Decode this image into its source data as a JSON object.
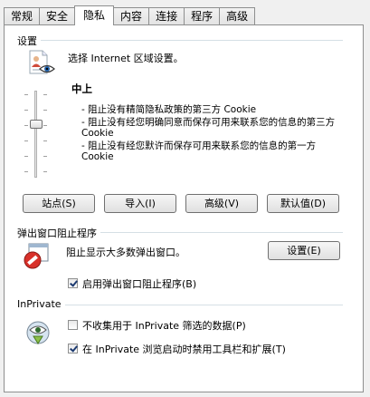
{
  "tabs": [
    "常规",
    "安全",
    "隐私",
    "内容",
    "连接",
    "程序",
    "高级"
  ],
  "active_tab": "隐私",
  "settings": {
    "group_title": "设置",
    "instruction": "选择 Internet 区域设置。",
    "level": "中上",
    "description": [
      "- 阻止没有精简隐私政策的第三方 Cookie",
      "- 阻止没有经您明确同意而保存可用来联系您的信息的第三方 Cookie",
      "- 阻止没有经您默许而保存可用来联系您的信息的第一方 Cookie"
    ],
    "buttons": {
      "sites": "站点(S)",
      "import": "导入(I)",
      "advanced": "高级(V)",
      "default": "默认值(D)"
    }
  },
  "popup": {
    "group_title": "弹出窗口阻止程序",
    "text": "阻止显示大多数弹出窗口。",
    "settings_button": "设置(E)",
    "enable_label": "启用弹出窗口阻止程序(B)",
    "enable_checked": true
  },
  "inprivate": {
    "group_title": "InPrivate",
    "collect_label": "不收集用于 InPrivate 筛选的数据(P)",
    "collect_checked": false,
    "disable_label": "在 InPrivate 浏览启动时禁用工具栏和扩展(T)",
    "disable_checked": true
  },
  "icons": {
    "privacy": "privacy-eye-icon",
    "popup": "popup-blocked-icon",
    "inprivate": "inprivate-icon"
  }
}
